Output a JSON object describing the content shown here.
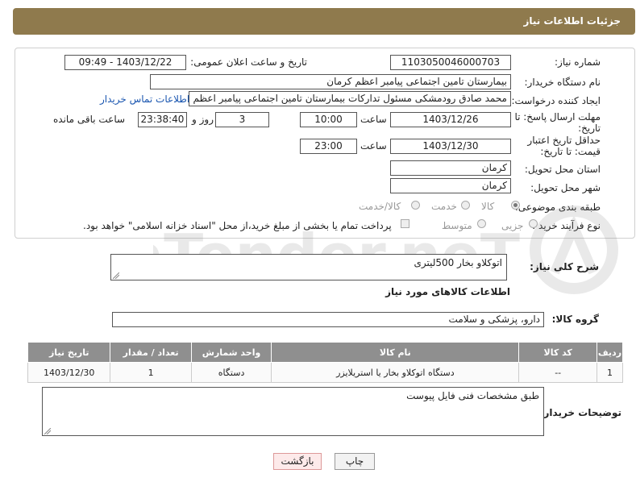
{
  "header": {
    "title": "جزئیات اطلاعات نیاز"
  },
  "need_number": {
    "label": "شماره نیاز:",
    "value": "1103050046000703"
  },
  "announce_datetime": {
    "label": "تاریخ و ساعت اعلان عمومی:",
    "value": "1403/12/22 - 09:49"
  },
  "buyer_org": {
    "label": "نام دستگاه خریدار:",
    "value": "بیمارستان تامین اجتماعی پیامبر اعظم کرمان"
  },
  "requester": {
    "label": "ایجاد کننده درخواست:",
    "value": "محمد صادق  رودمشکی مسئول تدارکات بیمارستان تامین اجتماعی پیامبر اعظم",
    "contact_link": "اطلاعات تماس خریدار"
  },
  "reply_deadline": {
    "label": "مهلت ارسال پاسخ: تا تاریخ:",
    "date": "1403/12/26",
    "time_label": "ساعت",
    "time": "10:00",
    "days": "3",
    "days_label": "روز و",
    "remaining": "23:38:40",
    "remaining_label": "ساعت باقی مانده"
  },
  "price_validity": {
    "label": "حداقل تاریخ اعتبار قیمت: تا تاریخ:",
    "date": "1403/12/30",
    "time_label": "ساعت",
    "time": "23:00"
  },
  "province": {
    "label": "استان محل تحویل:",
    "value": "کرمان"
  },
  "city": {
    "label": "شهر محل تحویل:",
    "value": "کرمان"
  },
  "category": {
    "label": "طبقه بندی موضوعی:",
    "options": [
      "کالا",
      "خدمت",
      "کالا/خدمت"
    ],
    "selected": "کالا"
  },
  "purchase_type": {
    "label": "نوع فرآیند خرید :",
    "options": [
      "جزیی",
      "متوسط"
    ],
    "note": "پرداخت تمام یا بخشی از مبلغ خرید،از محل \"اسناد خزانه اسلامی\" خواهد بود."
  },
  "description": {
    "label": "شرح کلی نیاز:",
    "value": "اتوکلاو بخار 500لیتری"
  },
  "goods_info": {
    "title": "اطلاعات کالاهای مورد نیاز"
  },
  "goods_group": {
    "label": "گروه کالا:",
    "value": "دارو، پزشکی و سلامت"
  },
  "table": {
    "headers": [
      "ردیف",
      "کد کالا",
      "نام کالا",
      "واحد شمارش",
      "تعداد / مقدار",
      "تاریخ نیاز"
    ],
    "rows": [
      [
        "1",
        "--",
        "دستگاه اتوکلاو بخار یا استریلایزر",
        "دستگاه",
        "1",
        "1403/12/30"
      ]
    ]
  },
  "buyer_notes": {
    "label": "توضیحات خریدار:",
    "value": "طبق مشخصات فنی فایل پیوست"
  },
  "buttons": {
    "print": "چاپ",
    "back": "بازگشت"
  },
  "watermark": {
    "text": "AriaTender.neT"
  }
}
